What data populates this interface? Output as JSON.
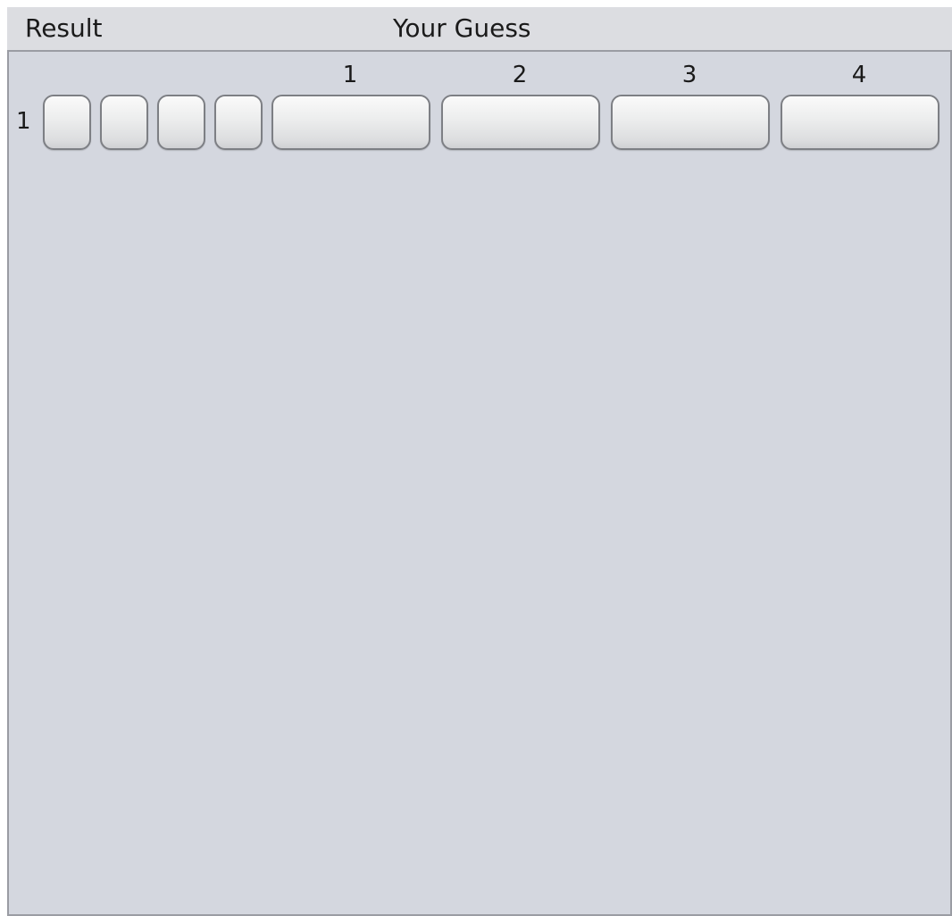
{
  "header": {
    "result_label": "Result",
    "guess_label": "Your Guess"
  },
  "columns": [
    "1",
    "2",
    "3",
    "4"
  ],
  "rows": [
    {
      "number": "1",
      "result_pegs": [
        "",
        "",
        "",
        ""
      ],
      "guess_slots": [
        "",
        "",
        "",
        ""
      ]
    }
  ]
}
